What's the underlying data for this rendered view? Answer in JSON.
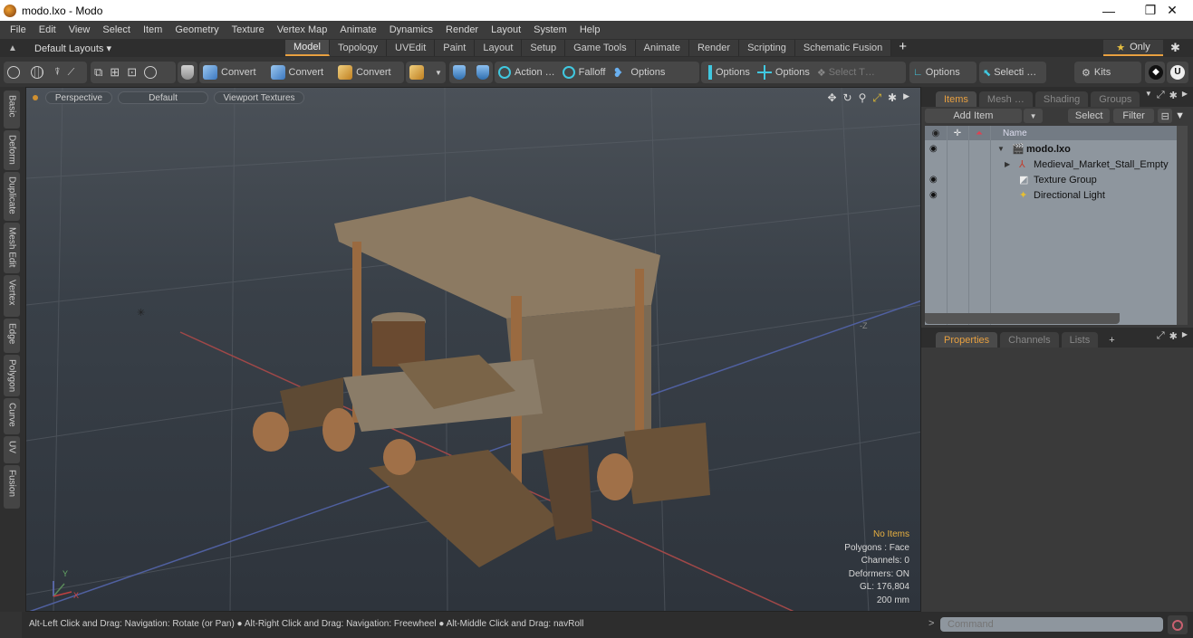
{
  "window": {
    "title": "modo.lxo - Modo",
    "controls": [
      "minimize",
      "restore",
      "close"
    ]
  },
  "menubar": [
    "File",
    "Edit",
    "View",
    "Select",
    "Item",
    "Geometry",
    "Texture",
    "Vertex Map",
    "Animate",
    "Dynamics",
    "Render",
    "Layout",
    "System",
    "Help"
  ],
  "layoutbar": {
    "layouts_label": "Default Layouts ▾",
    "tabs": [
      "Model",
      "Topology",
      "UVEdit",
      "Paint",
      "Layout",
      "Setup",
      "Game Tools",
      "Animate",
      "Render",
      "Scripting",
      "Schematic Fusion"
    ],
    "active_tab": "Model",
    "add_tab": "+",
    "only_label": "Only"
  },
  "toolbar": {
    "convert_1": "Convert",
    "convert_2": "Convert",
    "convert_3": "Convert",
    "action": "Action …",
    "falloff": "Falloff",
    "options_1": "Options",
    "options_2": "Options",
    "options_3": "Options",
    "select_t": "Select T…",
    "options_4": "Options",
    "selecti": "Selecti …",
    "kits": "Kits"
  },
  "left_tabs": [
    "Basic",
    "Deform",
    "Duplicate",
    "Mesh Edit",
    "Vertex",
    "Edge",
    "Polygon",
    "Curve",
    "UV",
    "Fusion"
  ],
  "viewport": {
    "view_mode": "Perspective",
    "shading": "Default",
    "textures": "Viewport Textures",
    "info": {
      "items": "No Items",
      "polygons": "Polygons : Face",
      "channels": "Channels: 0",
      "deformers": "Deformers: ON",
      "gl": "GL: 176,804",
      "scale": "200 mm"
    }
  },
  "items_panel": {
    "tabs": [
      "Items",
      "Mesh …",
      "Shading",
      "Groups"
    ],
    "active_tab": "Items",
    "add_item": "Add Item",
    "select": "Select",
    "filter": "Filter",
    "name_header": "Name",
    "tree": [
      {
        "label": "modo.lxo",
        "visible": true,
        "bold": true,
        "depth": 0
      },
      {
        "label": "Medieval_Market_Stall_Empty",
        "visible": false,
        "bold": false,
        "depth": 1
      },
      {
        "label": "Texture Group",
        "visible": true,
        "bold": false,
        "depth": 1
      },
      {
        "label": "Directional Light",
        "visible": true,
        "bold": false,
        "depth": 1
      }
    ]
  },
  "properties_panel": {
    "tabs": [
      "Properties",
      "Channels",
      "Lists"
    ],
    "active_tab": "Properties",
    "add_tab": "+"
  },
  "command": {
    "prompt": ">",
    "placeholder": "Command"
  },
  "statusbar": {
    "text": "Alt-Left Click and Drag: Navigation: Rotate (or Pan) ● Alt-Right Click and Drag: Navigation: Freewheel ● Alt-Middle Click and Drag: navRoll"
  }
}
